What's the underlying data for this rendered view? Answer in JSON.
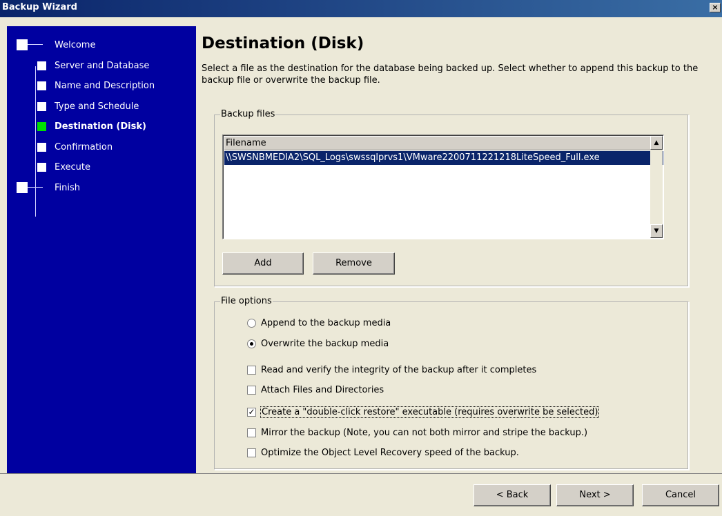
{
  "window": {
    "title": "Backup Wizard",
    "close": "×"
  },
  "sidebar": {
    "steps": [
      {
        "label": "Welcome"
      },
      {
        "label": "Server and Database"
      },
      {
        "label": "Name and Description"
      },
      {
        "label": "Type and Schedule"
      },
      {
        "label": "Destination (Disk)"
      },
      {
        "label": "Confirmation"
      },
      {
        "label": "Execute"
      },
      {
        "label": "Finish"
      }
    ],
    "current_step": "Destination (Disk)",
    "current_color": "#00e000"
  },
  "main": {
    "heading": "Destination (Disk)",
    "description": "Select a file as the destination for the database being backed up. Select whether to append this backup to the backup file or overwrite the backup file."
  },
  "backup_files": {
    "legend": "Backup files",
    "column_header": "Filename",
    "rows": [
      "\\\\SWSNBMEDIA2\\SQL_Logs\\swssqlprvs1\\VMware2200711221218LiteSpeed_Full.exe"
    ],
    "add_label": "Add",
    "remove_label": "Remove"
  },
  "file_options": {
    "legend": "File options",
    "append_label": "Append to the backup media",
    "overwrite_label": "Overwrite the backup media",
    "selected": "overwrite",
    "checks": [
      {
        "label": "Read and verify the integrity of the backup after it completes",
        "checked": false
      },
      {
        "label": "Attach Files and Directories",
        "checked": false
      },
      {
        "label": "Create a \"double-click restore\" executable (requires overwrite be selected)",
        "checked": true
      },
      {
        "label": "Mirror the backup (Note, you can not both mirror and stripe the backup.)",
        "checked": false
      },
      {
        "label": "Optimize the Object Level Recovery speed of the backup.",
        "checked": false
      }
    ]
  },
  "footer": {
    "back_label": "< Back",
    "next_label": "Next >",
    "cancel_label": "Cancel"
  }
}
